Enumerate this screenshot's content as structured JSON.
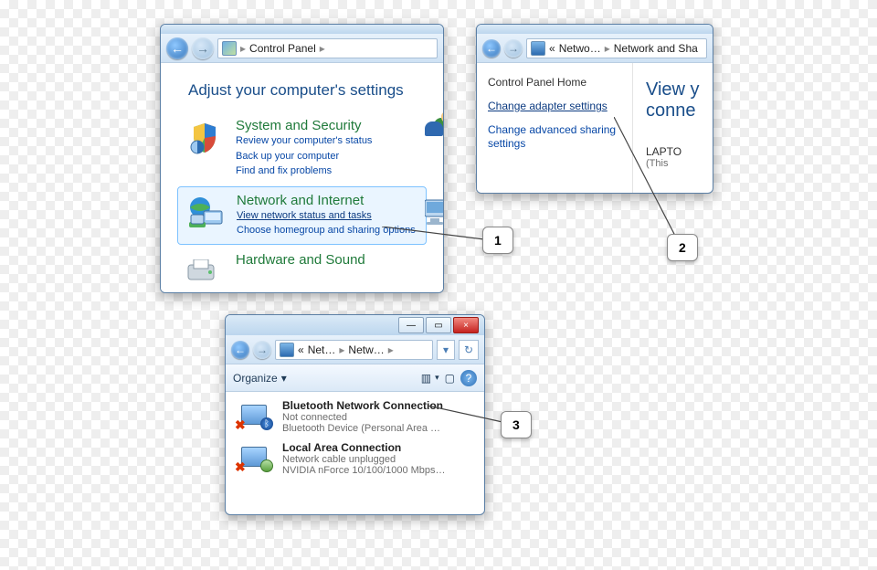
{
  "window1": {
    "breadcrumb": {
      "root": "Control Panel",
      "sep": "▸"
    },
    "heading": "Adjust your computer's settings",
    "categories": [
      {
        "title": "System and Security",
        "links": [
          "Review your computer's status",
          "Back up your computer",
          "Find and fix problems"
        ]
      },
      {
        "title": "Network and Internet",
        "links": [
          "View network status and tasks",
          "Choose homegroup and sharing options"
        ]
      },
      {
        "title": "Hardware and Sound",
        "links": []
      }
    ]
  },
  "window2": {
    "breadcrumb": {
      "pre": "«",
      "seg1": "Netwo…",
      "seg2": "Network and Sha",
      "sep": "▸"
    },
    "sidebar": {
      "title": "Control Panel Home",
      "links": [
        "Change adapter settings",
        "Change advanced sharing settings"
      ]
    },
    "pane": {
      "line1": "View y",
      "line2": "conne",
      "host1": "LAPTO",
      "host2": "(This"
    }
  },
  "window3": {
    "winctl": {
      "min": "—",
      "max": "▭",
      "close": "×"
    },
    "breadcrumb": {
      "pre": "«",
      "seg1": "Net…",
      "seg2": "Netw…",
      "sep": "▸",
      "dropdown": "▾",
      "refresh": "↻"
    },
    "toolbar": {
      "organize": "Organize",
      "dropdown": "▾",
      "views": "▥",
      "layout": "▢",
      "help": "?"
    },
    "items": [
      {
        "title": "Bluetooth Network Connection",
        "status": "Not connected",
        "device": "Bluetooth Device (Personal Area …",
        "sub_icon": "bluetooth"
      },
      {
        "title": "Local Area Connection",
        "status": "Network cable unplugged",
        "device": "NVIDIA nForce 10/100/1000 Mbps…",
        "sub_icon": "nic"
      }
    ]
  },
  "callouts": {
    "c1": "1",
    "c2": "2",
    "c3": "3"
  }
}
